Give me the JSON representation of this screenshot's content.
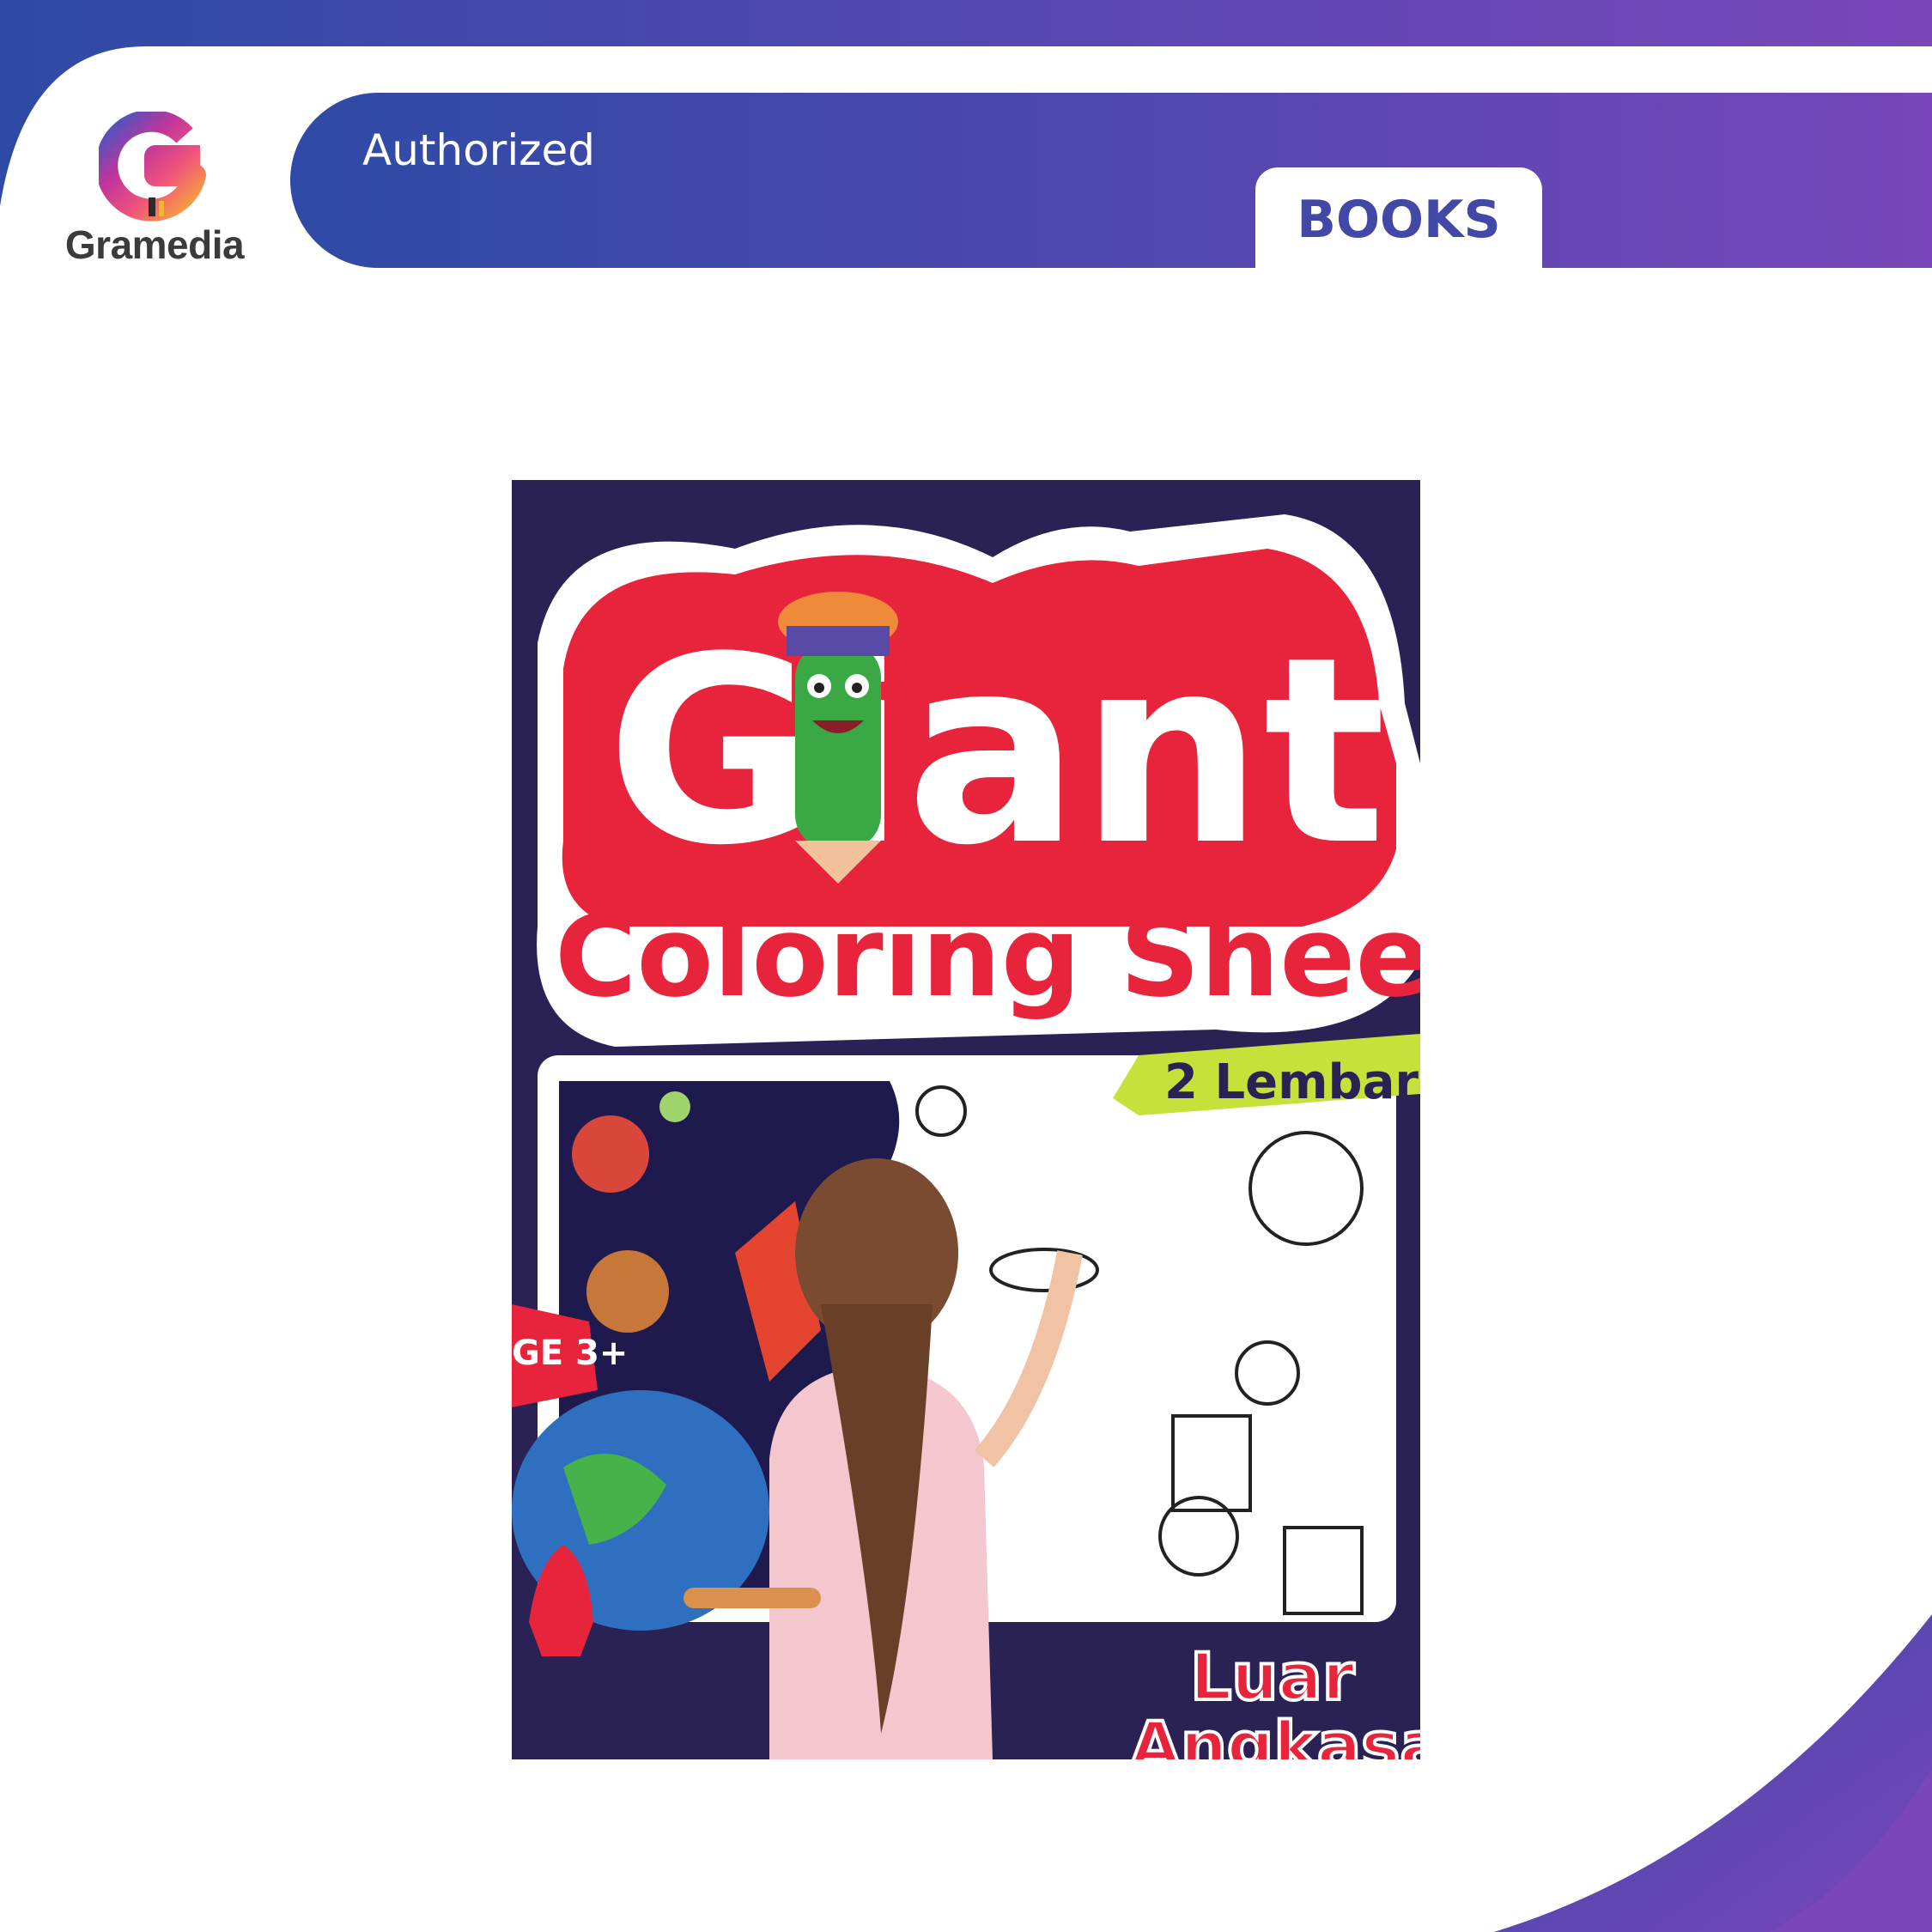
{
  "brand": {
    "name": "Gramedia",
    "logo_icon": "gramedia-g-logo-icon",
    "colors": {
      "primary": "#2f4aa6",
      "secondary": "#7a46b8"
    }
  },
  "header": {
    "authorized_label": "Authorized",
    "category_tab_label": "BOOKS"
  },
  "product": {
    "cover": {
      "title_word1": "Giant",
      "title_word2": "Coloring Sheet",
      "badge": "2 Lembar",
      "age_badge": "GE 3+",
      "subtitle_line1": "Luar",
      "subtitle_line2": "Angkasa",
      "colors": {
        "background": "#2a2155",
        "title_red": "#e8243c",
        "badge_green": "#c6e13a"
      }
    }
  }
}
